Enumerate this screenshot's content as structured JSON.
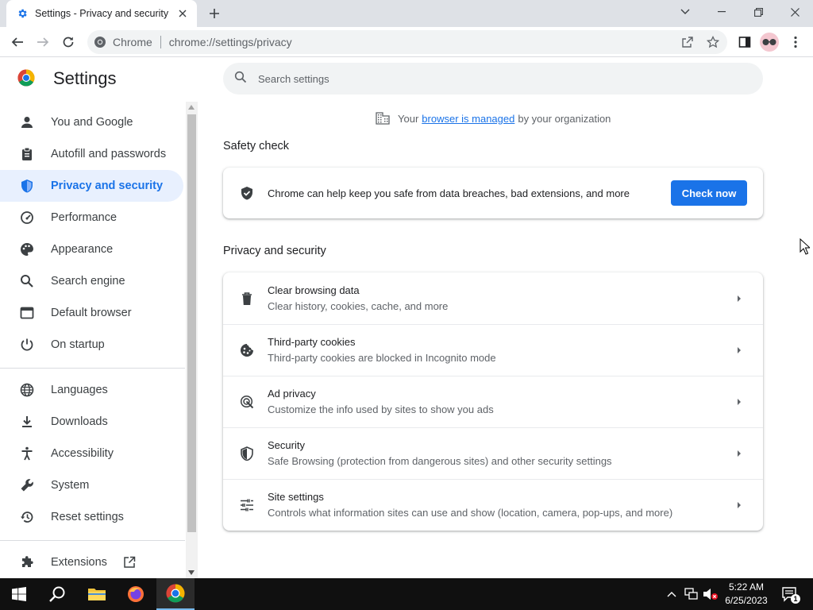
{
  "tab": {
    "title": "Settings - Privacy and security"
  },
  "omnibox": {
    "site_label": "Chrome",
    "url": "chrome://settings/privacy"
  },
  "header": {
    "title": "Settings",
    "search_placeholder": "Search settings"
  },
  "sidebar": {
    "items": [
      {
        "label": "You and Google",
        "icon": "person-icon",
        "active": false
      },
      {
        "label": "Autofill and passwords",
        "icon": "clipboard-icon",
        "active": false
      },
      {
        "label": "Privacy and security",
        "icon": "shield-icon",
        "active": true
      },
      {
        "label": "Performance",
        "icon": "speedometer-icon",
        "active": false
      },
      {
        "label": "Appearance",
        "icon": "palette-icon",
        "active": false
      },
      {
        "label": "Search engine",
        "icon": "search-icon",
        "active": false
      },
      {
        "label": "Default browser",
        "icon": "browser-window-icon",
        "active": false
      },
      {
        "label": "On startup",
        "icon": "power-icon",
        "active": false
      },
      {
        "label": "Languages",
        "icon": "globe-icon",
        "active": false
      },
      {
        "label": "Downloads",
        "icon": "download-icon",
        "active": false
      },
      {
        "label": "Accessibility",
        "icon": "accessibility-icon",
        "active": false
      },
      {
        "label": "System",
        "icon": "wrench-icon",
        "active": false
      },
      {
        "label": "Reset settings",
        "icon": "history-icon",
        "active": false
      },
      {
        "label": "Extensions",
        "icon": "puzzle-icon",
        "active": false
      }
    ]
  },
  "managed": {
    "prefix": "Your",
    "link": "browser is managed",
    "suffix": "by your organization"
  },
  "safety_check": {
    "section_title": "Safety check",
    "text": "Chrome can help keep you safe from data breaches, bad extensions, and more",
    "button": "Check now"
  },
  "privacy": {
    "section_title": "Privacy and security",
    "rows": [
      {
        "title": "Clear browsing data",
        "subtitle": "Clear history, cookies, cache, and more",
        "icon": "trash-icon"
      },
      {
        "title": "Third-party cookies",
        "subtitle": "Third-party cookies are blocked in Incognito mode",
        "icon": "cookie-icon"
      },
      {
        "title": "Ad privacy",
        "subtitle": "Customize the info used by sites to show you ads",
        "icon": "ad-privacy-icon"
      },
      {
        "title": "Security",
        "subtitle": "Safe Browsing (protection from dangerous sites) and other security settings",
        "icon": "shield-icon"
      },
      {
        "title": "Site settings",
        "subtitle": "Controls what information sites can use and show (location, camera, pop-ups, and more)",
        "icon": "sliders-icon"
      }
    ]
  },
  "taskbar": {
    "time": "5:22 AM",
    "date": "6/25/2023",
    "notification_count": "1"
  },
  "colors": {
    "accent": "#1a73e8",
    "active_nav_bg": "#e8f0fe",
    "tabstrip_bg": "#dee1e6",
    "taskbar_bg": "#101010"
  }
}
